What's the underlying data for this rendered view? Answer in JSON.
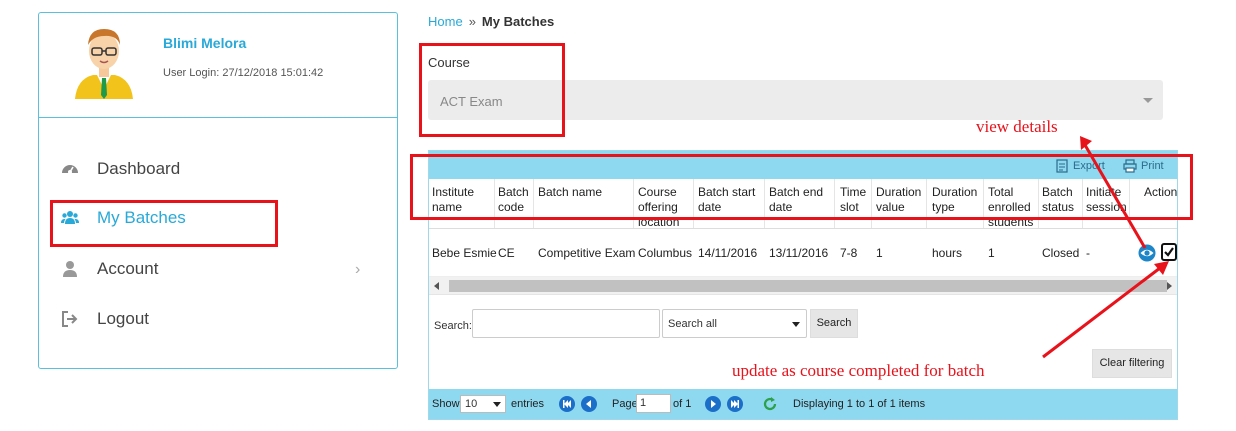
{
  "user": {
    "name": "Blimi Melora",
    "login_label": "User Login:",
    "login_time": "27/12/2018 15:01:42"
  },
  "nav": {
    "dashboard": "Dashboard",
    "my_batches": "My Batches",
    "account": "Account",
    "logout": "Logout"
  },
  "breadcrumb": {
    "home": "Home",
    "separator": "»",
    "current": "My Batches"
  },
  "course": {
    "label": "Course",
    "selected": "ACT Exam"
  },
  "toolbar": {
    "export": "Export",
    "print": "Print"
  },
  "table": {
    "headers": [
      "Institute name",
      "Batch code",
      "Batch name",
      "Course offering location",
      "Batch start date",
      "Batch end date",
      "Time slot",
      "Duration value",
      "Duration type",
      "Total enrolled students",
      "Batch status",
      "Initiate session",
      "Action"
    ],
    "rows": [
      [
        "Bebe Esmie",
        "CE",
        "Competitive Exam",
        "Columbus",
        "14/11/2016",
        "13/11/2016",
        "7-8",
        "1",
        "hours",
        "1",
        "Closed",
        "-"
      ]
    ]
  },
  "search": {
    "label": "Search:",
    "value": "",
    "scope": "Search all",
    "button": "Search",
    "clear": "Clear filtering"
  },
  "pager": {
    "show": "Show",
    "page_size": "10",
    "entries": "entries",
    "page_label": "Page",
    "page": "1",
    "of_label": "of 1",
    "status": "Displaying 1 to 1 of 1 items"
  },
  "annotations": {
    "view_details": "view details",
    "update_course": "update as course completed for batch"
  },
  "colors": {
    "accent": "#29a9d8",
    "toolbar": "#8ed8f0",
    "annotation": "#e8121b"
  }
}
